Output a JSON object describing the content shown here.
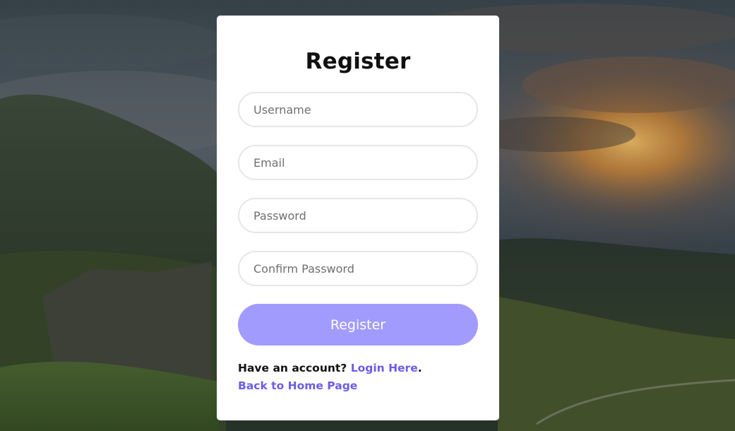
{
  "form": {
    "title": "Register",
    "username_placeholder": "Username",
    "email_placeholder": "Email",
    "password_placeholder": "Password",
    "confirm_placeholder": "Confirm Password",
    "submit_label": "Register"
  },
  "footer": {
    "have_account_text": "Have an account?",
    "login_link": "Login Here",
    "period": ".",
    "back_link": "Back to Home Page"
  },
  "colors": {
    "accent": "#a29bfe",
    "link": "#6c5ce7",
    "card": "#ffffff"
  }
}
